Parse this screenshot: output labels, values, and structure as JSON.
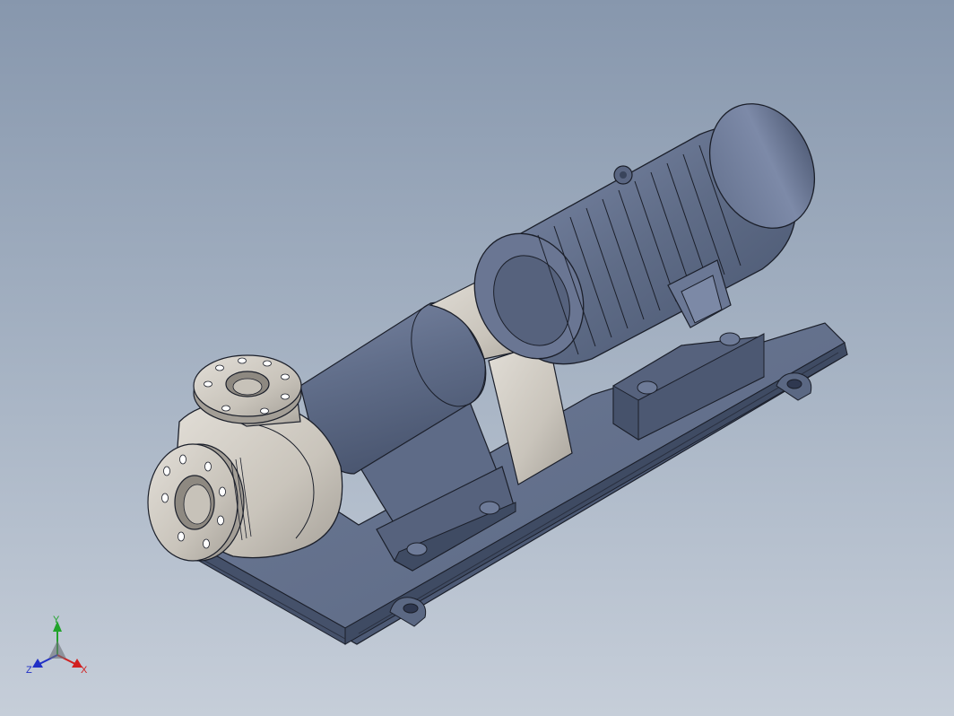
{
  "viewport": {
    "background_top": "#8797ad",
    "background_bottom": "#c6ced9"
  },
  "model": {
    "body_color": "#5f6c87",
    "body_dark": "#46536c",
    "body_light": "#8491ad",
    "metal_color": "#cdc8c0",
    "metal_dark": "#9f9a92",
    "edge_color": "#1b1f2a"
  },
  "triad": {
    "x_label": "X",
    "y_label": "Y",
    "z_label": "Z",
    "x_color": "#d11f1f",
    "y_color": "#21a32b",
    "z_color": "#2130c6"
  }
}
